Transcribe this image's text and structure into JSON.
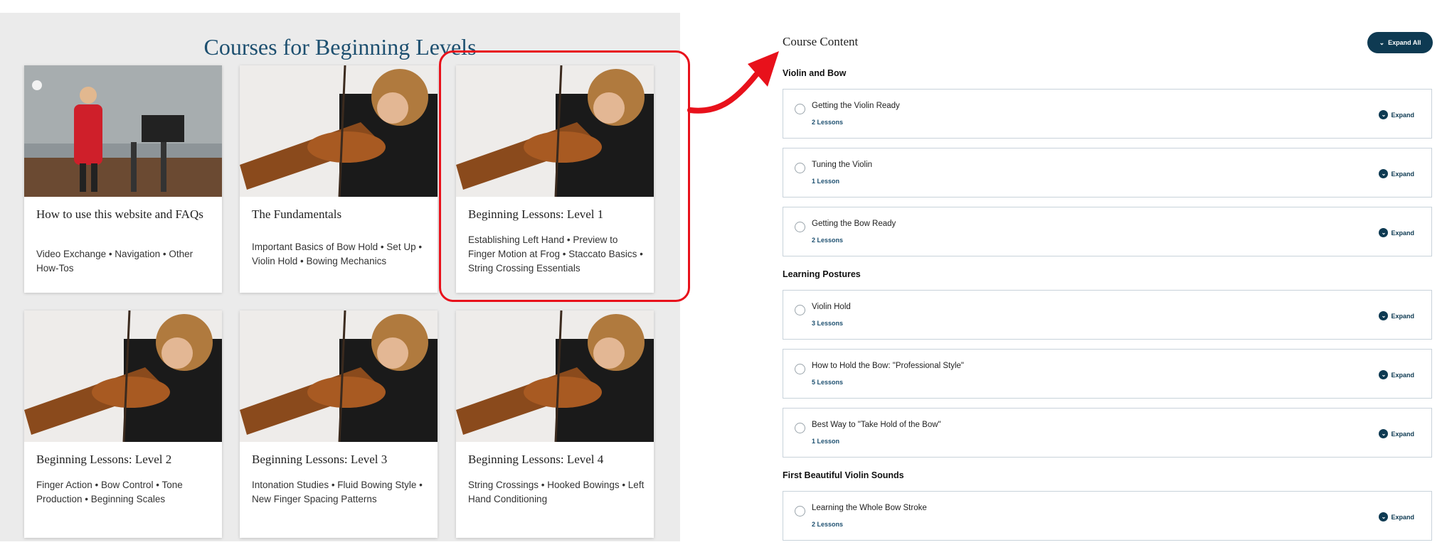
{
  "left": {
    "title": "Courses for Beginning Levels",
    "cards": [
      {
        "title": "How to use this website and FAQs",
        "desc": "Video Exchange • Navigation • Other How-Tos",
        "image": "instructor-studio-photo"
      },
      {
        "title": "The Fundamentals",
        "desc": "Important Basics of Bow Hold • Set Up • Violin Hold • Bowing Mechanics",
        "image": "violinist-closeup-photo"
      },
      {
        "title": "Beginning Lessons: Level 1",
        "desc": "Establishing Left Hand • Preview to Finger Motion at Frog • Staccato Basics • String Crossing Essentials",
        "image": "violinist-closeup-photo"
      },
      {
        "title": "Beginning Lessons: Level 2",
        "desc": "Finger Action • Bow Control • Tone Production • Beginning Scales",
        "image": "violinist-closeup-photo"
      },
      {
        "title": "Beginning Lessons: Level 3",
        "desc": "Intonation Studies • Fluid Bowing Style • New Finger Spacing Patterns",
        "image": "violinist-closeup-photo"
      },
      {
        "title": "Beginning Lessons: Level 4",
        "desc": "String Crossings • Hooked Bowings • Left Hand Conditioning",
        "image": "violinist-closeup-photo"
      }
    ]
  },
  "right": {
    "title": "Course Content",
    "expand_all_label": "Expand All",
    "expand_label": "Expand",
    "sections": [
      {
        "name": "Violin and Bow",
        "items": [
          {
            "title": "Getting the Violin Ready",
            "count": "2 Lessons"
          },
          {
            "title": "Tuning the Violin",
            "count": "1 Lesson"
          },
          {
            "title": "Getting the Bow Ready",
            "count": "2 Lessons"
          }
        ]
      },
      {
        "name": "Learning Postures",
        "items": [
          {
            "title": "Violin Hold",
            "count": "3 Lessons"
          },
          {
            "title": "How to Hold the Bow: \"Professional Style\"",
            "count": "5 Lessons"
          },
          {
            "title": "Best Way to \"Take Hold of the Bow\"",
            "count": "1 Lesson"
          }
        ]
      },
      {
        "name": "First Beautiful Violin Sounds",
        "items": [
          {
            "title": "Learning the Whole Bow Stroke",
            "count": "2 Lessons"
          }
        ]
      }
    ]
  },
  "colors": {
    "brand": "#1e5070",
    "highlight": "#e8111b",
    "button": "#0e3a52"
  }
}
